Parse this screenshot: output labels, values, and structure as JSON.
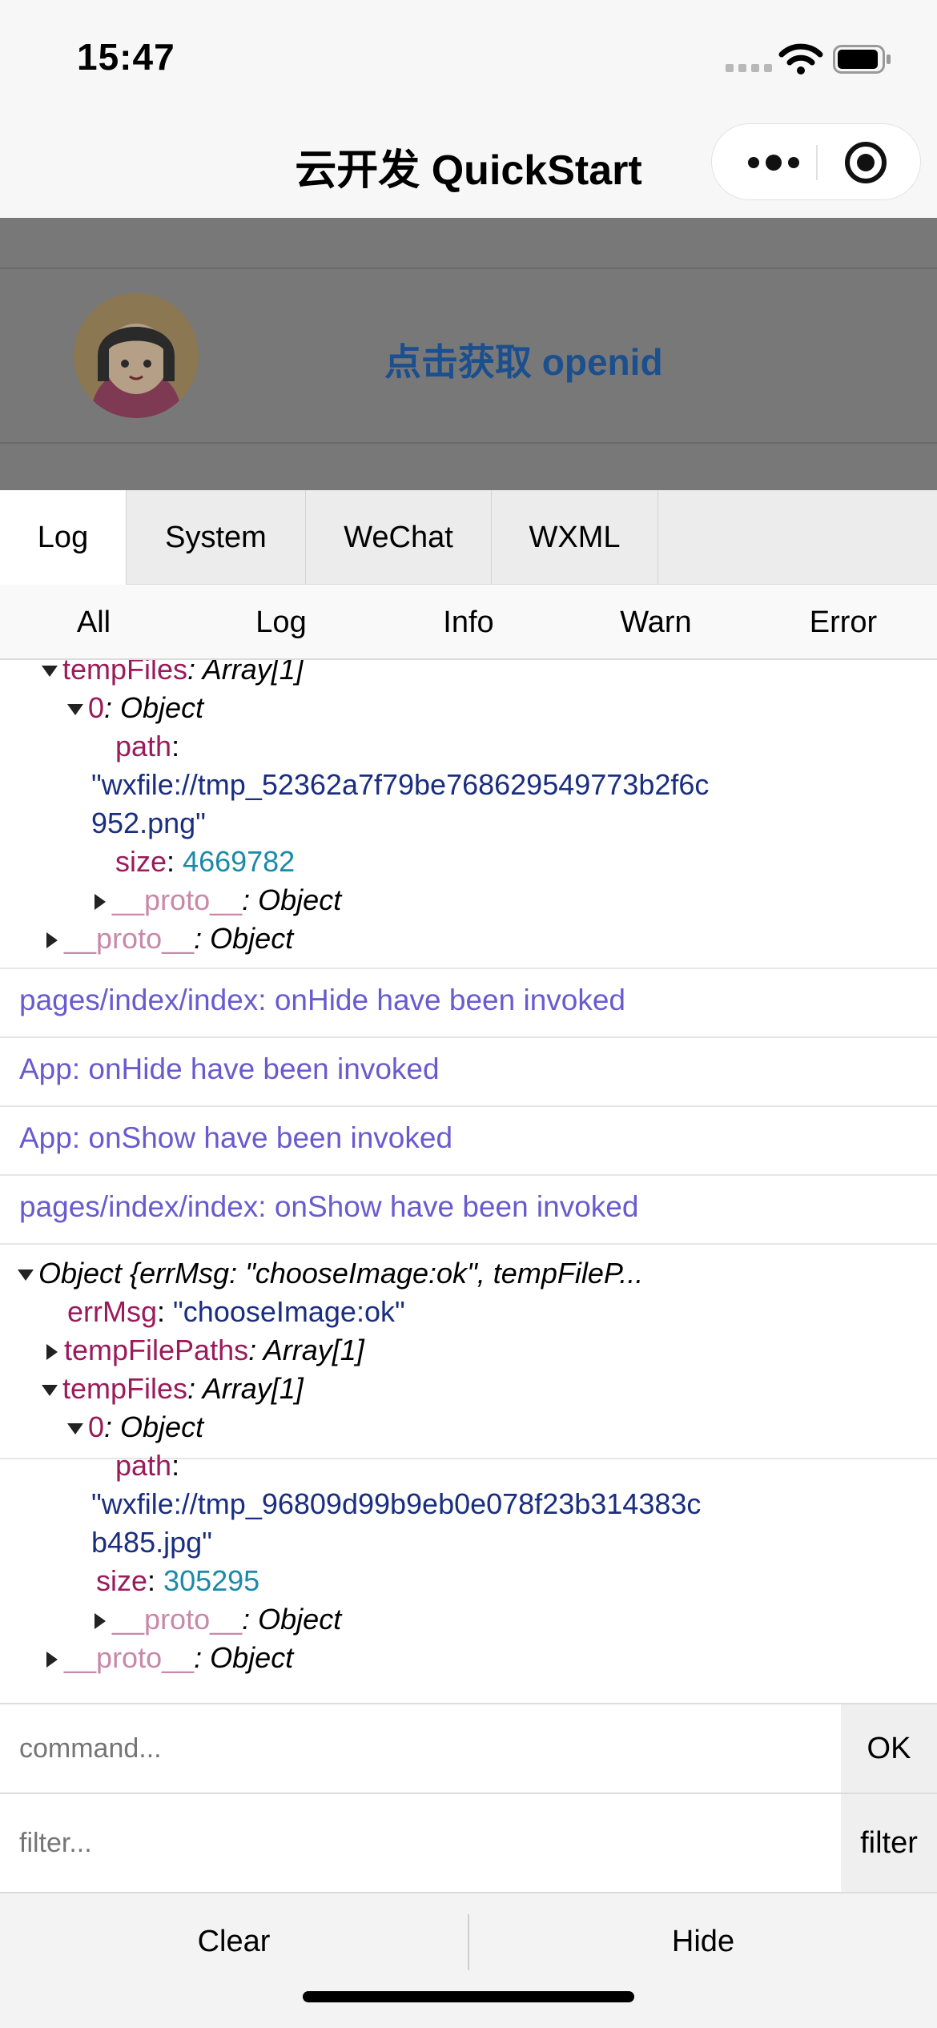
{
  "status_bar": {
    "time": "15:47"
  },
  "nav": {
    "title": "云开发 QuickStart"
  },
  "page": {
    "openid_button": "点击获取 openid"
  },
  "console": {
    "tabs": [
      "Log",
      "System",
      "WeChat",
      "WXML"
    ],
    "filters": [
      "All",
      "Log",
      "Info",
      "Warn",
      "Error"
    ],
    "entry1": {
      "tempfiles_key": "tempFiles",
      "tempfiles_val": ": Array[1]",
      "item_key": "0",
      "item_val": ": Object",
      "path_key": "path",
      "path_line1": "\"wxfile://tmp_52362a7f79be768629549773b2f6c",
      "path_line2": "952.png\"",
      "size_key": "size",
      "size_val": "4669782",
      "proto_key": "__proto__",
      "proto_val": ": Object"
    },
    "messages": [
      "pages/index/index: onHide have been invoked",
      "App: onHide have been invoked",
      "App: onShow have been invoked",
      "pages/index/index: onShow have been invoked"
    ],
    "entry2": {
      "summary": "Object {errMsg: \"chooseImage:ok\", tempFileP...",
      "errmsg_key": "errMsg",
      "errmsg_val": "\"chooseImage:ok\"",
      "paths_key": "tempFilePaths",
      "paths_val": ": Array[1]",
      "tempfiles_key": "tempFiles",
      "tempfiles_val": ": Array[1]",
      "item_key": "0",
      "item_val": ": Object",
      "path_key": "path",
      "path_line1": "\"wxfile://tmp_96809d99b9eb0e078f23b314383c",
      "path_line2": "b485.jpg\"",
      "size_key": "size",
      "size_val": "305295",
      "proto_key": "__proto__",
      "proto_val": ": Object"
    },
    "command_placeholder": "command...",
    "command_ok": "OK",
    "filter_placeholder": "filter...",
    "filter_button": "filter",
    "clear": "Clear",
    "hide": "Hide"
  }
}
